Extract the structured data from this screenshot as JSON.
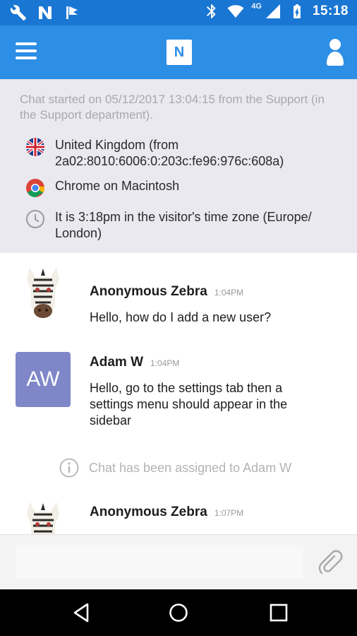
{
  "status_bar": {
    "time": "15:18",
    "network": "4G",
    "left_icons": [
      "wrench-icon",
      "n-notification-icon",
      "flag-notification-icon"
    ],
    "right_icons": [
      "bluetooth-icon",
      "wifi-icon",
      "signal-icon",
      "battery-icon"
    ]
  },
  "app_bar": {
    "logo_text": "N",
    "menu_icon": "hamburger-icon",
    "profile_icon": "person-icon",
    "color": "#2d8ee6"
  },
  "info": {
    "intro": "Chat started on 05/12/2017 13:04:15 from the Support (in the Support department).",
    "rows": [
      {
        "icon": "uk-flag-icon",
        "text": "United Kingdom (from 2a02:8010:6006:0:203c:fe96:976c:608a)"
      },
      {
        "icon": "chrome-icon",
        "text": "Chrome on Macintosh"
      },
      {
        "icon": "clock-icon",
        "text": "It is 3:18pm in the visitor's time zone (Europe/ London)"
      }
    ]
  },
  "messages": [
    {
      "name": "Anonymous Zebra",
      "time": "1:04PM",
      "body": "Hello, how do I add a new user?",
      "avatar": "zebra-avatar"
    },
    {
      "name": "Adam W",
      "time": "1:04PM",
      "body": "Hello, go to the settings tab then a settings menu should appear in the sidebar",
      "avatar_initials": "AW",
      "avatar_color": "#7f87c8"
    },
    {
      "name": "Anonymous Zebra",
      "time": "1:07PM",
      "body": "",
      "avatar": "zebra-avatar"
    }
  ],
  "system_note": {
    "icon": "info-icon",
    "text": "Chat has been assigned to Adam W"
  },
  "compose": {
    "placeholder": "",
    "attach_icon": "paperclip-icon"
  },
  "nav": [
    "back-icon",
    "home-icon",
    "recents-icon"
  ]
}
